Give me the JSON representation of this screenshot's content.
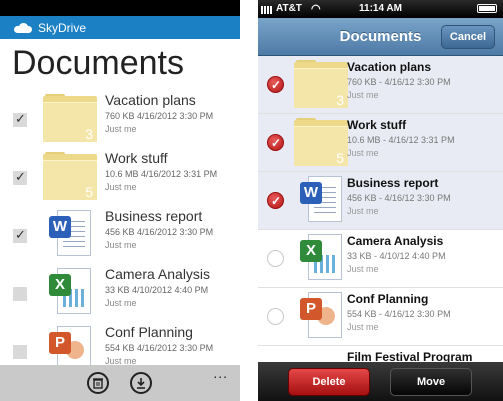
{
  "wp": {
    "app_name": "SkyDrive",
    "title": "Documents",
    "items": [
      {
        "name": "Vacation plans",
        "meta": "760 KB  4/16/2012 3:30 PM",
        "modified_by": "Just me",
        "type": "folder",
        "count": "3",
        "checked": true
      },
      {
        "name": "Work stuff",
        "meta": "10.6 MB  4/16/2012 3:31 PM",
        "modified_by": "Just me",
        "type": "folder",
        "count": "5",
        "checked": true
      },
      {
        "name": "Business report",
        "meta": "456 KB  4/16/2012 3:30 PM",
        "modified_by": "Just me",
        "type": "word",
        "checked": true
      },
      {
        "name": "Camera Analysis",
        "meta": "33 KB  4/10/2012 4:40 PM",
        "modified_by": "Just me",
        "type": "excel",
        "checked": false
      },
      {
        "name": "Conf Planning",
        "meta": "554 KB  4/16/2012 3:30 PM",
        "modified_by": "Just me",
        "type": "ppt",
        "checked": false
      }
    ],
    "more_label": "...",
    "icons": {
      "delete": "trash-icon",
      "download": "download-icon",
      "logo": "skydrive-cloud-icon"
    },
    "accent": "#1c80c4"
  },
  "ios": {
    "carrier": "AT&T",
    "time": "11:14 AM",
    "title": "Documents",
    "cancel_label": "Cancel",
    "items": [
      {
        "name": "Vacation plans",
        "meta": "760 KB - 4/16/12 3:30 PM",
        "modified_by": "Just me",
        "type": "folder",
        "count": "3",
        "selected": true
      },
      {
        "name": "Work stuff",
        "meta": "10.6 MB - 4/16/12 3:31 PM",
        "modified_by": "Just me",
        "type": "folder",
        "count": "5",
        "selected": true
      },
      {
        "name": "Business report",
        "meta": "456 KB - 4/16/12 3:30 PM",
        "modified_by": "Just me",
        "type": "word",
        "selected": true
      },
      {
        "name": "Camera Analysis",
        "meta": "33 KB - 4/10/12 4:40 PM",
        "modified_by": "Just me",
        "type": "excel",
        "selected": false
      },
      {
        "name": "Conf Planning",
        "meta": "554 KB - 4/16/12 3:30 PM",
        "modified_by": "Just me",
        "type": "ppt",
        "selected": false
      }
    ],
    "peek_item": "Film Festival Program",
    "delete_label": "Delete",
    "move_label": "Move",
    "accent_delete": "#c81e1e"
  }
}
